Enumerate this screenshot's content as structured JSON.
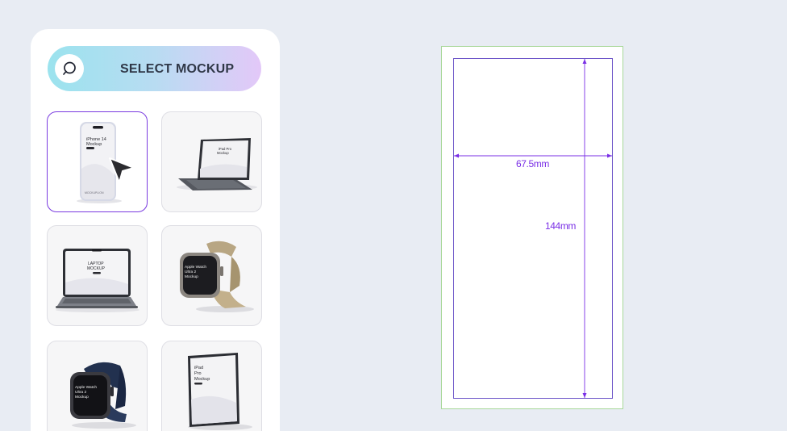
{
  "sidebar": {
    "select_button": {
      "label": "SELECT MOCKUP",
      "icon": "search-icon"
    },
    "mockups": [
      {
        "name": "iphone-14-mockup",
        "screen_text": "iPhone 14 Mockup",
        "brand": "MOCKUPLION",
        "selected": true
      },
      {
        "name": "ipad-pro-keyboard-mockup",
        "screen_text": "iPad Pro Mockup",
        "selected": false
      },
      {
        "name": "laptop-mockup",
        "screen_text": "LAPTOP MOCKUP",
        "selected": false
      },
      {
        "name": "apple-watch-ultra-2-tan-mockup",
        "screen_text": "Apple Watch Ultra 2 Mockup",
        "selected": false
      },
      {
        "name": "apple-watch-ultra-2-navy-mockup",
        "screen_text": "Apple Watch Ultra 2 Mockup",
        "selected": false
      },
      {
        "name": "ipad-pro-mockup",
        "screen_text": "iPad Pro Mockup",
        "selected": false
      }
    ]
  },
  "canvas": {
    "width_label": "67.5mm",
    "height_label": "144mm"
  },
  "colors": {
    "accent": "#7a3be0",
    "dimension": "#7a2fe6",
    "canvas_border": "#a9d89a",
    "background": "#e8ecf3"
  }
}
